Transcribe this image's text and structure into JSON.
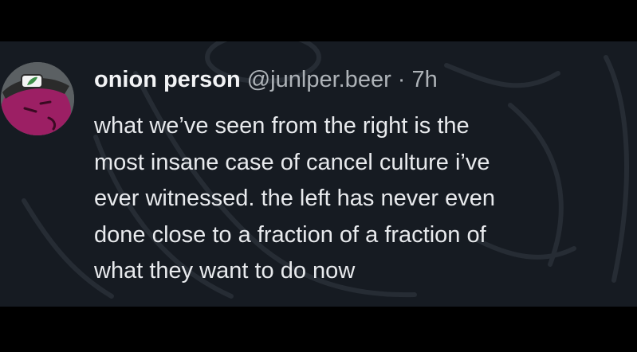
{
  "post": {
    "author": {
      "display_name": "onion person",
      "handle": "@junlper.beer",
      "separator": "·",
      "time_ago": "7h",
      "avatar_icon": "onion-character-avatar-icon"
    },
    "text_lines": [
      "what we’ve seen from the right is the",
      "most insane case of cancel culture i’ve",
      "ever witnessed.  the left has never even",
      "done close to a fraction of a fraction of",
      "what they want to do now"
    ]
  },
  "colors": {
    "letterbox": "#000000",
    "card_background": "#161b22",
    "name_text": "#f2f3f5",
    "meta_text": "#aeb3b8",
    "body_text": "#e8eaed",
    "avatar_body": "#9c1f64",
    "avatar_cap": "#2b2b2b",
    "avatar_badge": "#3f8f4a"
  }
}
